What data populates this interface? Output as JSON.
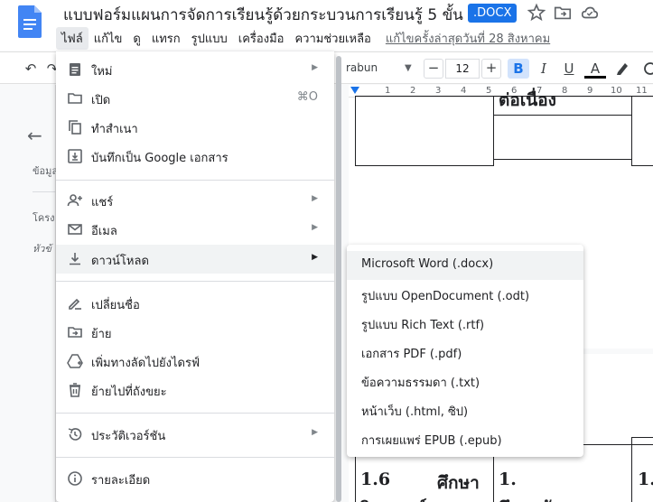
{
  "header": {
    "title": "แบบฟอร์มแผนการจัดการเรียนรู้ด้วยกระบวนการเรียนรู้ 5 ขั้น",
    "badge": ".DOCX",
    "last_edit": "แก้ไขครั้งล่าสุดวันที่ 28 สิงหาคม"
  },
  "menubar": [
    {
      "label": "ไฟล์",
      "active": true
    },
    {
      "label": "แก้ไข"
    },
    {
      "label": "ดู"
    },
    {
      "label": "แทรก"
    },
    {
      "label": "รูปแบบ"
    },
    {
      "label": "เครื่องมือ"
    },
    {
      "label": "ความช่วยเหลือ"
    }
  ],
  "toolbar": {
    "font": "rabun",
    "font_size": "12",
    "minus": "−",
    "plus": "+",
    "bold": "B",
    "italic": "I",
    "underline": "U",
    "text_color": "A"
  },
  "outline": {
    "line1": "ข้อมูล",
    "line2": "โครง",
    "line3": "หัวข้"
  },
  "ruler": {
    "mark1": "1",
    "mark2": "2",
    "mark3": "3",
    "mark4": "4",
    "mark5": "5",
    "mark6": "6",
    "mark7": "7",
    "mark8": "8",
    "mark9": "9",
    "mark10": "10",
    "mark11": "11"
  },
  "doc": {
    "top_text": "ต่อเนื่อง",
    "row_a": "1.6",
    "row_b": "ศึกษา",
    "row_c": "1.",
    "row_d": "1.",
    "row_e": "วิเคราะห์",
    "row_f": "ศึกษาลักษณะ"
  },
  "file_menu": {
    "items": [
      {
        "label": "ใหม่",
        "icon": "doc-icon",
        "submenu": true
      },
      {
        "label": "เปิด",
        "icon": "folder-icon",
        "shortcut": "⌘O"
      },
      {
        "label": "ทำสำเนา",
        "icon": "copy-icon"
      },
      {
        "label": "บันทึกเป็น Google เอกสาร",
        "icon": "save-as-icon"
      },
      {
        "label": "แชร์",
        "icon": "person-add-icon",
        "submenu": true
      },
      {
        "label": "อีเมล",
        "icon": "mail-icon",
        "submenu": true
      },
      {
        "label": "ดาวน์โหลด",
        "icon": "download-icon",
        "submenu": true
      },
      {
        "label": "เปลี่ยนชื่อ",
        "icon": "rename-icon"
      },
      {
        "label": "ย้าย",
        "icon": "move-icon"
      },
      {
        "label": "เพิ่มทางลัดไปยังไดรฟ์",
        "icon": "drive-shortcut-icon"
      },
      {
        "label": "ย้ายไปที่ถังขยะ",
        "icon": "trash-icon"
      },
      {
        "label": "ประวัติเวอร์ชัน",
        "icon": "history-icon",
        "submenu": true
      },
      {
        "label": "รายละเอียด",
        "icon": "info-icon"
      }
    ],
    "submenu_arrow": "▶"
  },
  "download_menu": {
    "items": [
      "Microsoft Word (.docx)",
      "รูปแบบ OpenDocument (.odt)",
      "รูปแบบ Rich Text (.rtf)",
      "เอกสาร PDF (.pdf)",
      "ข้อความธรรมดา (.txt)",
      "หน้าเว็บ (.html, ซิป)",
      "การเผยแพร่ EPUB (.epub)"
    ]
  },
  "colors": {
    "accent": "#1a73e8",
    "hover": "#f1f3f4",
    "logo": "#4285f4"
  }
}
